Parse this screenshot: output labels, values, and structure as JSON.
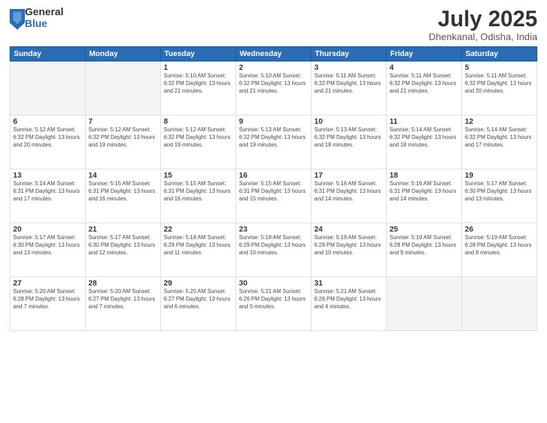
{
  "logo": {
    "general": "General",
    "blue": "Blue"
  },
  "title": "July 2025",
  "location": "Dhenkanal, Odisha, India",
  "days_header": [
    "Sunday",
    "Monday",
    "Tuesday",
    "Wednesday",
    "Thursday",
    "Friday",
    "Saturday"
  ],
  "weeks": [
    [
      {
        "day": "",
        "info": ""
      },
      {
        "day": "",
        "info": ""
      },
      {
        "day": "1",
        "info": "Sunrise: 5:10 AM\nSunset: 6:32 PM\nDaylight: 13 hours and 21 minutes."
      },
      {
        "day": "2",
        "info": "Sunrise: 5:10 AM\nSunset: 6:32 PM\nDaylight: 13 hours and 21 minutes."
      },
      {
        "day": "3",
        "info": "Sunrise: 5:11 AM\nSunset: 6:32 PM\nDaylight: 13 hours and 21 minutes."
      },
      {
        "day": "4",
        "info": "Sunrise: 5:11 AM\nSunset: 6:32 PM\nDaylight: 13 hours and 21 minutes."
      },
      {
        "day": "5",
        "info": "Sunrise: 5:11 AM\nSunset: 6:32 PM\nDaylight: 13 hours and 20 minutes."
      }
    ],
    [
      {
        "day": "6",
        "info": "Sunrise: 5:12 AM\nSunset: 6:32 PM\nDaylight: 13 hours and 20 minutes."
      },
      {
        "day": "7",
        "info": "Sunrise: 5:12 AM\nSunset: 6:32 PM\nDaylight: 13 hours and 19 minutes."
      },
      {
        "day": "8",
        "info": "Sunrise: 5:12 AM\nSunset: 6:32 PM\nDaylight: 13 hours and 19 minutes."
      },
      {
        "day": "9",
        "info": "Sunrise: 5:13 AM\nSunset: 6:32 PM\nDaylight: 13 hours and 19 minutes."
      },
      {
        "day": "10",
        "info": "Sunrise: 5:13 AM\nSunset: 6:32 PM\nDaylight: 13 hours and 18 minutes."
      },
      {
        "day": "11",
        "info": "Sunrise: 5:14 AM\nSunset: 6:32 PM\nDaylight: 13 hours and 18 minutes."
      },
      {
        "day": "12",
        "info": "Sunrise: 5:14 AM\nSunset: 6:32 PM\nDaylight: 13 hours and 17 minutes."
      }
    ],
    [
      {
        "day": "13",
        "info": "Sunrise: 5:14 AM\nSunset: 6:31 PM\nDaylight: 13 hours and 17 minutes."
      },
      {
        "day": "14",
        "info": "Sunrise: 5:15 AM\nSunset: 6:31 PM\nDaylight: 13 hours and 16 minutes."
      },
      {
        "day": "15",
        "info": "Sunrise: 5:15 AM\nSunset: 6:31 PM\nDaylight: 13 hours and 16 minutes."
      },
      {
        "day": "16",
        "info": "Sunrise: 5:15 AM\nSunset: 6:31 PM\nDaylight: 13 hours and 15 minutes."
      },
      {
        "day": "17",
        "info": "Sunrise: 5:16 AM\nSunset: 6:31 PM\nDaylight: 13 hours and 14 minutes."
      },
      {
        "day": "18",
        "info": "Sunrise: 5:16 AM\nSunset: 6:31 PM\nDaylight: 13 hours and 14 minutes."
      },
      {
        "day": "19",
        "info": "Sunrise: 5:17 AM\nSunset: 6:30 PM\nDaylight: 13 hours and 13 minutes."
      }
    ],
    [
      {
        "day": "20",
        "info": "Sunrise: 5:17 AM\nSunset: 6:30 PM\nDaylight: 13 hours and 13 minutes."
      },
      {
        "day": "21",
        "info": "Sunrise: 5:17 AM\nSunset: 6:30 PM\nDaylight: 13 hours and 12 minutes."
      },
      {
        "day": "22",
        "info": "Sunrise: 5:18 AM\nSunset: 6:29 PM\nDaylight: 13 hours and 11 minutes."
      },
      {
        "day": "23",
        "info": "Sunrise: 5:18 AM\nSunset: 6:29 PM\nDaylight: 13 hours and 10 minutes."
      },
      {
        "day": "24",
        "info": "Sunrise: 5:19 AM\nSunset: 6:29 PM\nDaylight: 13 hours and 10 minutes."
      },
      {
        "day": "25",
        "info": "Sunrise: 5:19 AM\nSunset: 6:28 PM\nDaylight: 13 hours and 9 minutes."
      },
      {
        "day": "26",
        "info": "Sunrise: 5:19 AM\nSunset: 6:28 PM\nDaylight: 13 hours and 8 minutes."
      }
    ],
    [
      {
        "day": "27",
        "info": "Sunrise: 5:20 AM\nSunset: 6:28 PM\nDaylight: 13 hours and 7 minutes."
      },
      {
        "day": "28",
        "info": "Sunrise: 5:20 AM\nSunset: 6:27 PM\nDaylight: 13 hours and 7 minutes."
      },
      {
        "day": "29",
        "info": "Sunrise: 5:20 AM\nSunset: 6:27 PM\nDaylight: 13 hours and 6 minutes."
      },
      {
        "day": "30",
        "info": "Sunrise: 5:21 AM\nSunset: 6:26 PM\nDaylight: 13 hours and 5 minutes."
      },
      {
        "day": "31",
        "info": "Sunrise: 5:21 AM\nSunset: 6:26 PM\nDaylight: 13 hours and 4 minutes."
      },
      {
        "day": "",
        "info": ""
      },
      {
        "day": "",
        "info": ""
      }
    ]
  ]
}
